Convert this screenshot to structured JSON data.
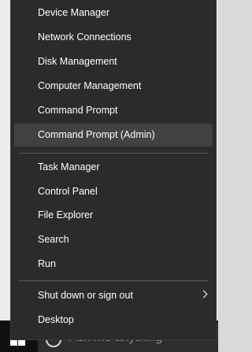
{
  "menu": {
    "items": [
      {
        "label": "Device Manager"
      },
      {
        "label": "Network Connections"
      },
      {
        "label": "Disk Management"
      },
      {
        "label": "Computer Management"
      },
      {
        "label": "Command Prompt"
      },
      {
        "label": "Command Prompt (Admin)"
      },
      {
        "label": "Task Manager"
      },
      {
        "label": "Control Panel"
      },
      {
        "label": "File Explorer"
      },
      {
        "label": "Search"
      },
      {
        "label": "Run"
      },
      {
        "label": "Shut down or sign out"
      },
      {
        "label": "Desktop"
      }
    ],
    "highlighted_item": "Command Prompt (Admin)"
  },
  "taskbar": {
    "search_placeholder": "Ask me anything"
  },
  "colors": {
    "menu_background": "#2b2b2b",
    "highlight": "#414141",
    "text": "#ffffff",
    "taskbar": "#101010"
  }
}
